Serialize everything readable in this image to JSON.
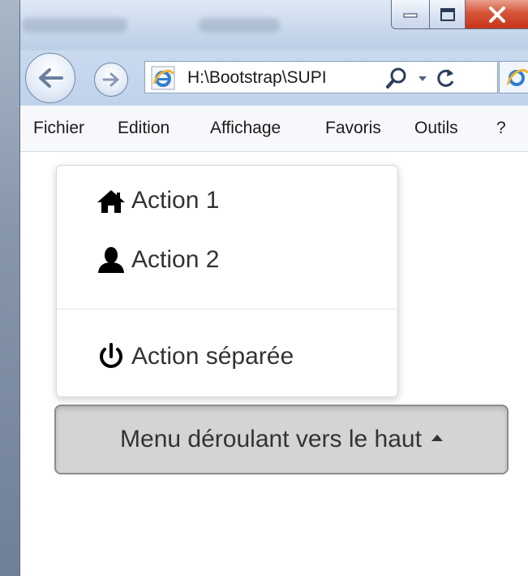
{
  "browser": {
    "tab_ghosts": [
      "PUBLIPOSTAGE",
      "RÉVISION"
    ],
    "address": "H:\\Bootstrap\\SUPI",
    "controls": {
      "minimize_icon": "minimize-icon",
      "maximize_icon": "maximize-icon",
      "close_icon": "close-icon"
    }
  },
  "menubar": {
    "items": [
      "Fichier",
      "Edition",
      "Affichage",
      "Favoris",
      "Outils",
      "?"
    ]
  },
  "dropdown": {
    "items": [
      {
        "label": "Action 1",
        "icon": "home-icon"
      },
      {
        "label": "Action 2",
        "icon": "user-icon"
      },
      {
        "label": "Action séparée",
        "icon": "power-icon"
      }
    ]
  },
  "button": {
    "label": "Menu déroulant vers le haut"
  },
  "colors": {
    "button_bg": "#d4d4d4",
    "text": "#333333",
    "close_button": "#c7341a"
  }
}
